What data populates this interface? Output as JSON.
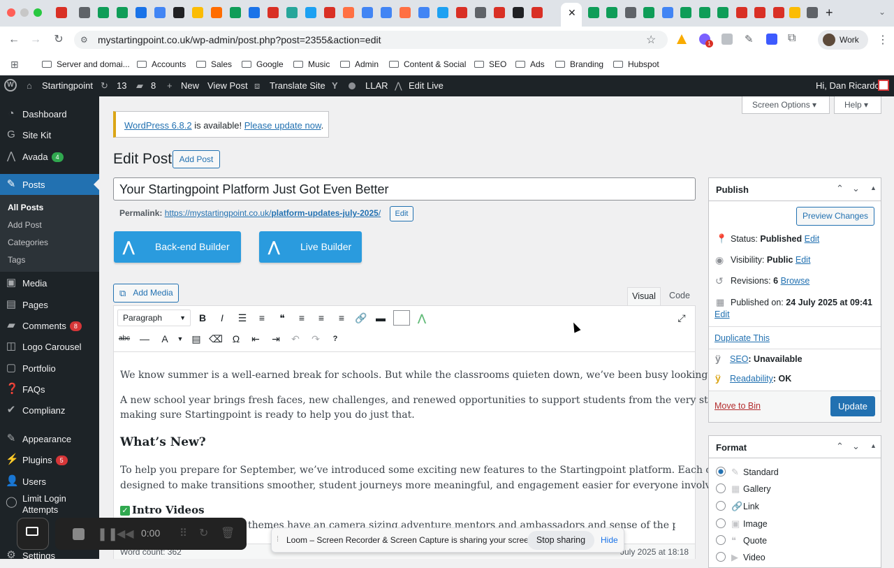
{
  "browser": {
    "url": "mystartingpoint.co.uk/wp-admin/post.php?post=2355&action=edit",
    "profile_label": "Work",
    "extension_badge": "1",
    "bookmarks": [
      "Server and domai...",
      "Accounts",
      "Sales",
      "Google",
      "Music",
      "Admin",
      "Content & Social",
      "SEO",
      "Ads",
      "Branding",
      "Hubspot"
    ]
  },
  "adminbar": {
    "site_name": "Startingpoint",
    "updates_count": "13",
    "comments_count": "8",
    "new_label": "New",
    "view_post": "View Post",
    "translate": "Translate Site",
    "llar": "LLAR",
    "edit_live": "Edit Live",
    "greeting": "Hi, Dan Ricardo"
  },
  "sidebar": {
    "items": [
      {
        "label": "Dashboard",
        "icon": "dashboard-icon"
      },
      {
        "label": "Site Kit",
        "icon": "google-g-icon"
      },
      {
        "label": "Avada",
        "badge": "4",
        "icon": "avada-icon"
      },
      {
        "label": "Posts",
        "icon": "pin-icon"
      },
      {
        "label": "Media",
        "icon": "media-icon"
      },
      {
        "label": "Pages",
        "icon": "pages-icon"
      },
      {
        "label": "Comments",
        "badge": "8",
        "icon": "comment-icon"
      },
      {
        "label": "Logo Carousel",
        "icon": "carousel-icon"
      },
      {
        "label": "Portfolio",
        "icon": "portfolio-icon"
      },
      {
        "label": "FAQs",
        "icon": "faq-icon"
      },
      {
        "label": "Complianz",
        "icon": "shield-icon"
      },
      {
        "label": "Appearance",
        "icon": "brush-icon"
      },
      {
        "label": "Plugins",
        "badge": "5",
        "icon": "plug-icon"
      },
      {
        "label": "Users",
        "icon": "user-icon"
      },
      {
        "label": "Limit Login Attempts",
        "icon": "lock-icon"
      },
      {
        "label": "Settings",
        "icon": "settings-icon"
      }
    ],
    "submenu": [
      "All Posts",
      "Add Post",
      "Categories",
      "Tags"
    ]
  },
  "screen_options": "Screen Options",
  "help": "Help",
  "notice": {
    "link1": "WordPress 6.8.2",
    "middle": " is available! ",
    "link2": "Please update now",
    "end": "."
  },
  "page_title": "Edit Post",
  "add_post": "Add Post",
  "post_title": "Your Startingpoint Platform Just Got Even Better",
  "permalink": {
    "label": "Permalink:",
    "url_base": "https://mystartingpoint.co.uk/",
    "slug": "platform-updates-july-2025",
    "trail": "/",
    "edit": "Edit"
  },
  "builders": {
    "backend": "Back-end Builder",
    "live": "Live Builder"
  },
  "add_media": "Add Media",
  "editor_tabs": {
    "visual": "Visual",
    "code": "Code"
  },
  "format_select": "Paragraph",
  "content": {
    "p1": "We know summer is a well-earned break for schools. But while the classrooms quieten down, we’ve been busy looking ahead.",
    "p2a": "A new school year brings fresh faces, new challenges, and renewed opportunities to support students from the very start. We’re",
    "p2b": "making sure Startingpoint is ready to help you do just that.",
    "h2": "What’s New?",
    "p3a": "To help you prepare for September, we’ve introduced some exciting new features to the Startingpoint platform. Each one is",
    "p3b": "designed to make transitions smoother, student journeys more meaningful, and engagement easier for everyone involved:",
    "h3": "Intro Videos",
    "p4_visible": "themes have an camera sizing adventure mentors and ambassadors and sense of the person behind"
  },
  "word_count": "Word count: 362",
  "last_edited": "July 2025 at 18:18",
  "publish": {
    "title": "Publish",
    "preview": "Preview Changes",
    "status_label": "Status:",
    "status_value": "Published",
    "visibility_label": "Visibility:",
    "visibility_value": "Public",
    "revisions_label": "Revisions:",
    "revisions_value": "6",
    "browse": "Browse",
    "published_label": "Published on:",
    "published_value": "24 July 2025 at 09:41",
    "edit": "Edit",
    "duplicate": "Duplicate This",
    "seo_label": "SEO",
    "seo_value": ": Unavailable",
    "readability_label": "Readability",
    "readability_value": ": OK",
    "move_to_bin": "Move to Bin",
    "update": "Update"
  },
  "format": {
    "title": "Format",
    "options": [
      "Standard",
      "Gallery",
      "Link",
      "Image",
      "Quote",
      "Video"
    ],
    "selected": "Standard"
  },
  "loom": {
    "timer": "0:00",
    "share_text": "Loom – Screen Recorder & Screen Capture is sharing your screen.",
    "stop": "Stop sharing",
    "hide": "Hide"
  },
  "colors": {
    "wp_blue": "#2271b1",
    "admin_dark": "#1d2327",
    "avada_blue": "#2a9bde",
    "badge_red": "#d63638"
  }
}
